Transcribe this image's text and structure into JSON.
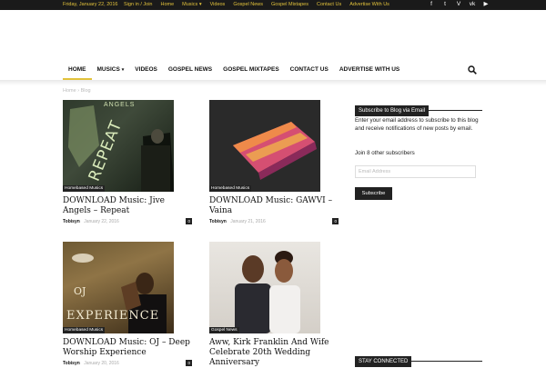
{
  "topbar": {
    "date": "Friday, January 22, 2016",
    "links": [
      "Sign in / Join",
      "Home",
      "Musics",
      "Videos",
      "Gospel News",
      "Gospel Mixtapes",
      "Contact Us",
      "Advertise With Us"
    ],
    "musics_caret": "▾",
    "social_icons": [
      "facebook-icon",
      "twitter-icon",
      "vimeo-icon",
      "vk-icon",
      "youtube-icon"
    ],
    "social_glyphs": [
      "f",
      "t",
      "V",
      "vk",
      "▶"
    ]
  },
  "nav": {
    "items": [
      "HOME",
      "MUSICS",
      "VIDEOS",
      "GOSPEL NEWS",
      "GOSPEL MIXTAPES",
      "CONTACT US",
      "ADVERTISE WITH US"
    ],
    "caret": "▾",
    "accent": "#e2c23b"
  },
  "breadcrumb": {
    "home": "Home",
    "sep": "›",
    "current": "Blog"
  },
  "posts": [
    {
      "thumb_text": "ANGELS",
      "thumb_text2": "REPEAT",
      "category": "Homebased Musics",
      "title": "DOWNLOAD Music: Jive Angels – Repeat",
      "author": "Tobisyn",
      "date": "January 22, 2016",
      "comments": "0"
    },
    {
      "category": "Homebased Musics",
      "title": "DOWNLOAD Music: GAWVI – Vaina",
      "author": "Tobisyn",
      "date": "January 21, 2016",
      "comments": "0"
    },
    {
      "thumb_text": "OJ",
      "thumb_text2": "EXPERIENCE",
      "category": "Homebased Musics",
      "title": "DOWNLOAD Music: OJ – Deep Worship Experience",
      "author": "Tobisyn",
      "date": "January 20, 2016",
      "comments": "0"
    },
    {
      "category": "Gospel News",
      "title": "Aww, Kirk Franklin And Wife Celebrate 20th Wedding Anniversary"
    }
  ],
  "sidebar": {
    "subscribe_title": "Subscribe to Blog via Email",
    "subscribe_text": "Enter your email address to subscribe to this blog and receive notifications of new posts by email.",
    "subscribers": "Join 8 other subscribers",
    "email_placeholder": "Email Address",
    "subscribe_button": "Subscribe",
    "stay_connected": "STAY CONNECTED"
  }
}
